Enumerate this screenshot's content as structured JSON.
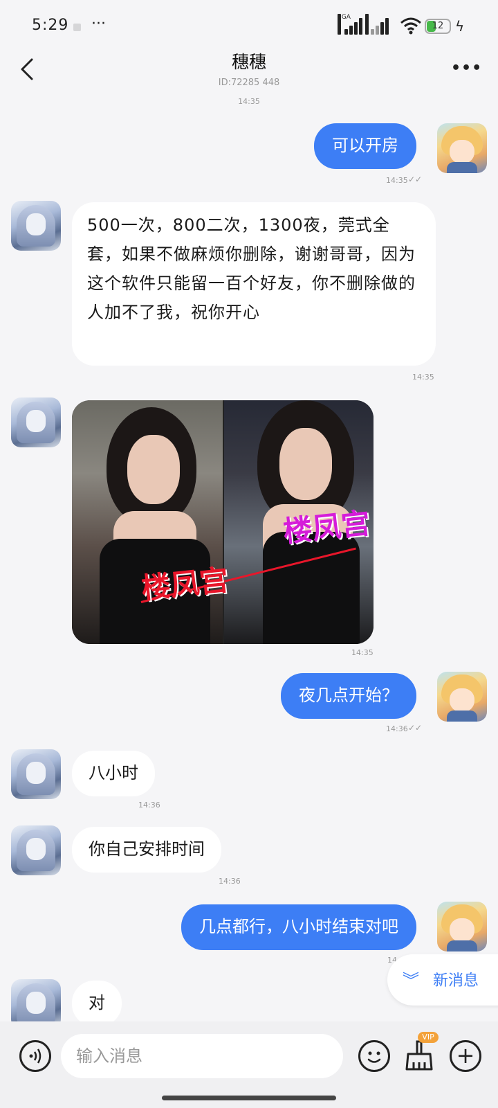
{
  "status_bar": {
    "time": "5:29",
    "more": "···",
    "net1": "5GA",
    "net2": "6",
    "battery": "12"
  },
  "header": {
    "title": "穗穗",
    "subtitle": "ID:72285 448",
    "more": "•••"
  },
  "messages": [
    {
      "side": "time",
      "time": "14:35"
    },
    {
      "side": "me",
      "text": "可以开房",
      "time": "14:35",
      "status": "read"
    },
    {
      "side": "other",
      "text": "500一次，800二次，1300夜，莞式全套，如果不做麻烦你删除，谢谢哥哥，因为这个软件只能留一百个好友，你不删除做的人加不了我，祝你开心",
      "time": "14:35"
    },
    {
      "side": "other",
      "type": "image",
      "time": "14:35",
      "watermark_1": "楼凤宫",
      "watermark_2": "楼凤宫"
    },
    {
      "side": "me",
      "text": "夜几点开始？",
      "time": "14:36",
      "status": "read"
    },
    {
      "side": "other",
      "text": "八小时",
      "time": "14:36"
    },
    {
      "side": "other",
      "text": "你自己安排时间",
      "time": "14:36"
    },
    {
      "side": "me",
      "text": "几点都行，八小时结束对吧",
      "time": "14"
    },
    {
      "side": "other",
      "text": "对"
    }
  ],
  "new_message_pill": {
    "icon": "double-chevron-down-icon",
    "label": "新消息"
  },
  "input_bar": {
    "placeholder": "输入消息",
    "vip_badge": "VIP",
    "plus": "+"
  },
  "colors": {
    "accent": "#3d7ef5",
    "background": "#f5f5f7",
    "vip": "#f3a23a"
  },
  "tick_mark": "✓✓"
}
